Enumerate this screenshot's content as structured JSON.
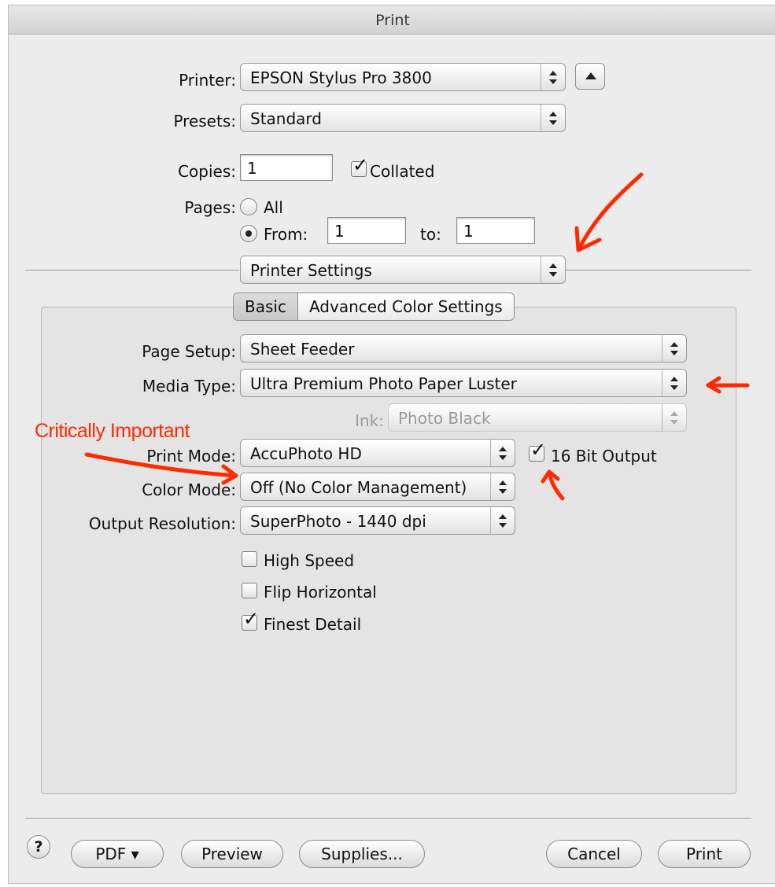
{
  "window": {
    "title": "Print"
  },
  "printer": {
    "label": "Printer:",
    "value": "EPSON Stylus Pro 3800"
  },
  "presets": {
    "label": "Presets:",
    "value": "Standard"
  },
  "copies": {
    "label": "Copies:",
    "value": "1",
    "collated_label": "Collated",
    "collated": true
  },
  "pages": {
    "label": "Pages:",
    "all_label": "All",
    "from_label": "From:",
    "from_value": "1",
    "to_label": "to:",
    "to_value": "1",
    "selected": "from"
  },
  "section_popup": {
    "value": "Printer Settings"
  },
  "tabs": [
    {
      "label": "Basic",
      "selected": true
    },
    {
      "label": "Advanced Color Settings",
      "selected": false
    }
  ],
  "settings": {
    "page_setup": {
      "label": "Page Setup:",
      "value": "Sheet Feeder"
    },
    "media_type": {
      "label": "Media Type:",
      "value": "Ultra Premium Photo Paper Luster"
    },
    "ink": {
      "label": "Ink:",
      "value": "Photo Black",
      "disabled": true
    },
    "print_mode": {
      "label": "Print Mode:",
      "value": "AccuPhoto HD"
    },
    "bit_output": {
      "label": "16 Bit Output",
      "checked": true
    },
    "color_mode": {
      "label": "Color Mode:",
      "value": "Off (No Color Management)"
    },
    "output_resolution": {
      "label": "Output Resolution:",
      "value": "SuperPhoto - 1440 dpi"
    },
    "checkboxes": [
      {
        "label": "High Speed",
        "checked": false
      },
      {
        "label": "Flip Horizontal",
        "checked": false
      },
      {
        "label": "Finest Detail",
        "checked": true
      }
    ]
  },
  "annotation": {
    "text": "Critically Important",
    "color": "#ff2a00"
  },
  "footer": {
    "help": "?",
    "pdf": "PDF ▾",
    "preview": "Preview",
    "supplies": "Supplies...",
    "cancel": "Cancel",
    "print": "Print"
  }
}
